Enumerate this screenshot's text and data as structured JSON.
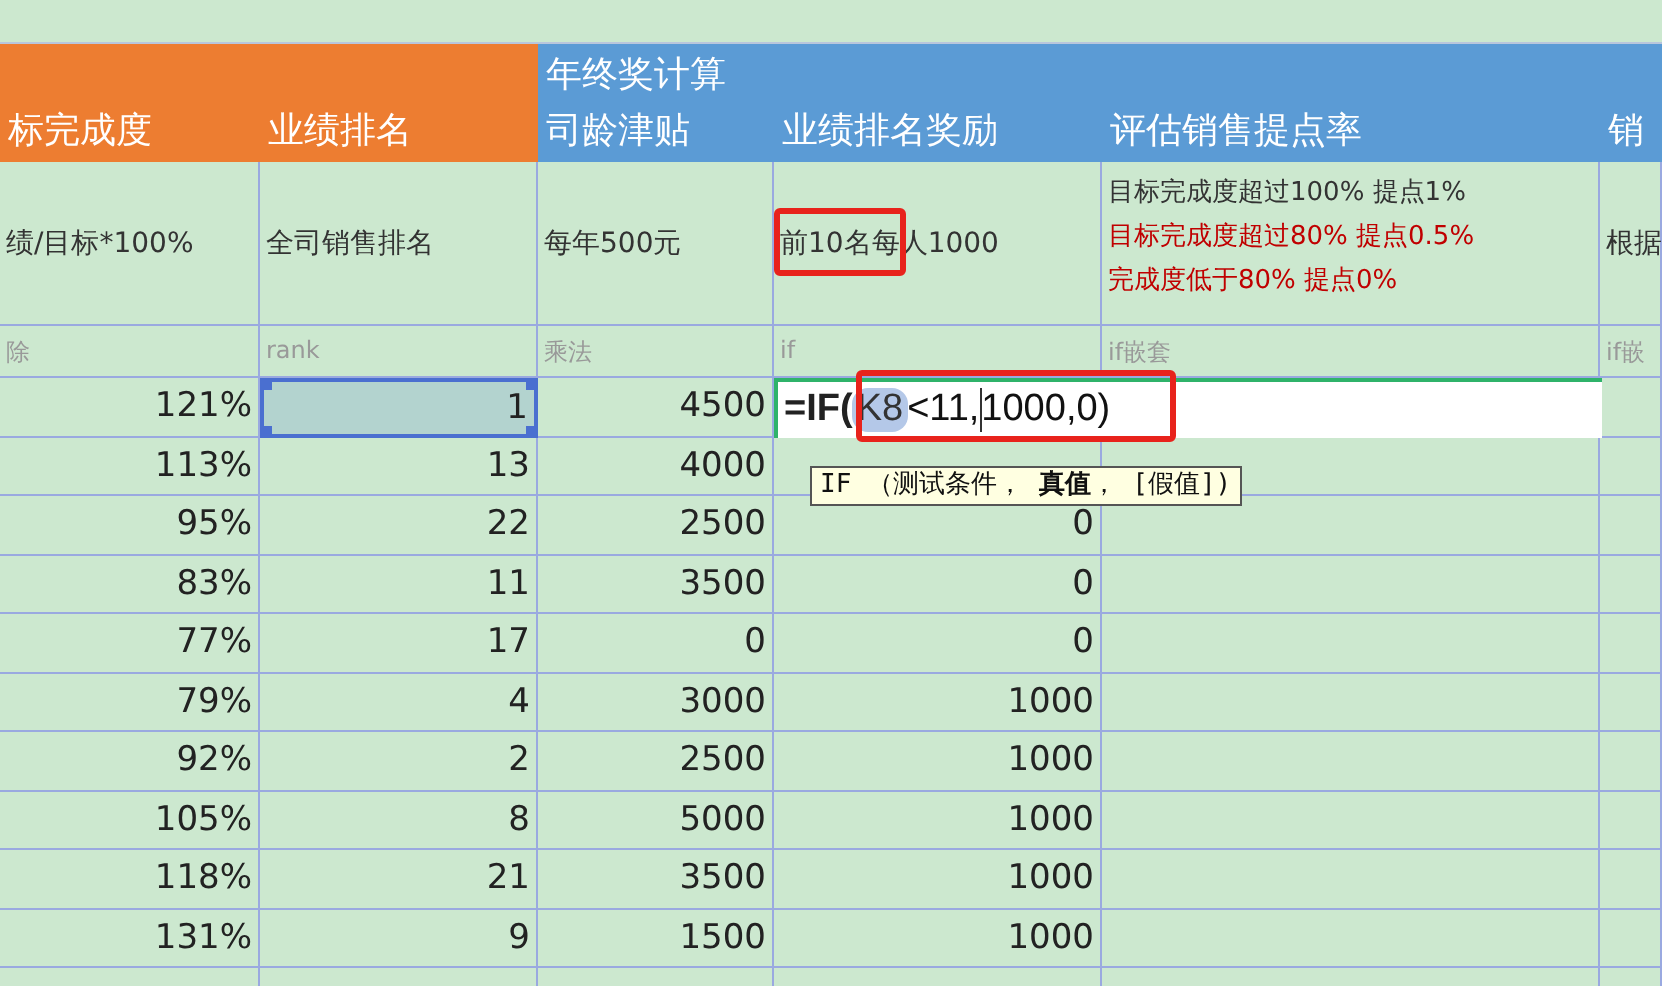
{
  "group_title": "年终奖计算",
  "columns": [
    {
      "header": "标完成度",
      "color": "#ed7d31",
      "description": [
        {
          "text": "绩/目标*100%",
          "kind": "normal"
        }
      ],
      "hint": "除",
      "annotated": false
    },
    {
      "header": "业绩排名",
      "color": "#ed7d31",
      "description": [
        {
          "text": "全司销售排名",
          "kind": "normal"
        }
      ],
      "hint": "rank",
      "annotated": false
    },
    {
      "header": "司龄津贴",
      "color": "#5b9bd5",
      "description": [
        {
          "text": "每年500元",
          "kind": "normal"
        }
      ],
      "hint": "乘法",
      "annotated": false
    },
    {
      "header": "业绩排名奖励",
      "color": "#5b9bd5",
      "description": [
        {
          "text": "前10名每人1000",
          "kind": "normal"
        }
      ],
      "hint": "if",
      "annotated": true
    },
    {
      "header": "评估销售提点率",
      "color": "#5b9bd5",
      "description": [
        {
          "text": "目标完成度超过100% 提点1%",
          "kind": "normal"
        },
        {
          "text": "目标完成度超过80%  提点0.5%",
          "kind": "alert"
        },
        {
          "text": "完成度低于80%  提点0%",
          "kind": "alert"
        }
      ],
      "hint": "if嵌套",
      "annotated": false
    },
    {
      "header": "销",
      "color": "#5b9bd5",
      "description": [
        {
          "text": "根据",
          "kind": "normal"
        }
      ],
      "hint": "if嵌",
      "annotated": false
    }
  ],
  "rows": [
    {
      "completion": "121%",
      "rank": "1",
      "rank_selected": true,
      "allowance": "4500",
      "editing": true
    },
    {
      "completion": "113%",
      "rank": "13",
      "rank_selected": false,
      "allowance": "4000",
      "editing": false
    },
    {
      "completion": "95%",
      "rank": "22",
      "rank_selected": false,
      "allowance": "2500",
      "bonus": "0",
      "editing": false
    },
    {
      "completion": "83%",
      "rank": "11",
      "rank_selected": false,
      "allowance": "3500",
      "bonus": "0",
      "editing": false
    },
    {
      "completion": "77%",
      "rank": "17",
      "rank_selected": false,
      "allowance": "0",
      "bonus": "0",
      "editing": false
    },
    {
      "completion": "79%",
      "rank": "4",
      "rank_selected": false,
      "allowance": "3000",
      "bonus": "1000",
      "editing": false
    },
    {
      "completion": "92%",
      "rank": "2",
      "rank_selected": false,
      "allowance": "2500",
      "bonus": "1000",
      "editing": false
    },
    {
      "completion": "105%",
      "rank": "8",
      "rank_selected": false,
      "allowance": "5000",
      "bonus": "1000",
      "editing": false
    },
    {
      "completion": "118%",
      "rank": "21",
      "rank_selected": false,
      "allowance": "3500",
      "bonus": "1000",
      "editing": false
    },
    {
      "completion": "131%",
      "rank": "9",
      "rank_selected": false,
      "allowance": "1500",
      "bonus": "1000",
      "editing": false
    }
  ],
  "formula": {
    "function": "=IF(",
    "reference": "K8",
    "condition": " <11,",
    "tail": "1000,0)",
    "annotated": true
  },
  "tooltip": "IF （测试条件， **真值**， [假值])"
}
